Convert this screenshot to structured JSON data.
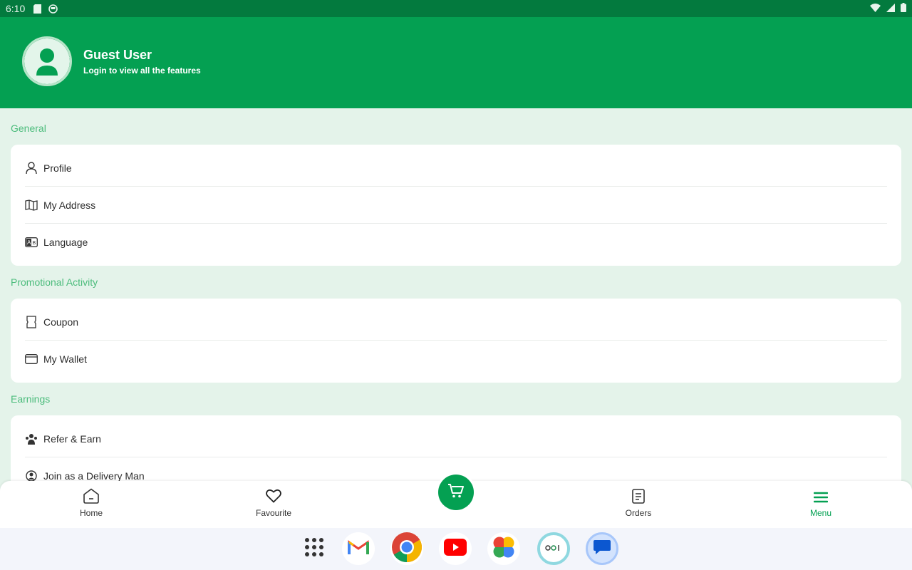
{
  "status_bar": {
    "time": "6:10",
    "icons": [
      "sd-card-icon",
      "face-icon",
      "wifi-icon",
      "signal-icon",
      "battery-icon"
    ]
  },
  "header": {
    "user_name": "Guest User",
    "subtitle": "Login to view all the features",
    "bg_color": "#04a052"
  },
  "sections": [
    {
      "title": "General",
      "items": [
        {
          "label": "Profile",
          "icon": "person-icon"
        },
        {
          "label": "My Address",
          "icon": "map-icon"
        },
        {
          "label": "Language",
          "icon": "language-icon"
        }
      ]
    },
    {
      "title": "Promotional Activity",
      "items": [
        {
          "label": "Coupon",
          "icon": "coupon-icon"
        },
        {
          "label": "My Wallet",
          "icon": "wallet-icon"
        }
      ]
    },
    {
      "title": "Earnings",
      "items": [
        {
          "label": "Refer & Earn",
          "icon": "refer-icon"
        },
        {
          "label": "Join as a Delivery Man",
          "icon": "delivery-man-icon"
        }
      ]
    }
  ],
  "bottom_nav": {
    "items": [
      {
        "label": "Home",
        "icon": "home-icon"
      },
      {
        "label": "Favourite",
        "icon": "heart-icon"
      },
      {
        "label": "Orders",
        "icon": "orders-icon"
      },
      {
        "label": "Menu",
        "icon": "menu-icon",
        "active": true
      }
    ],
    "cart_icon": "cart-icon",
    "accent_color": "#04a052"
  },
  "taskbar": {
    "apps": [
      "app-drawer-icon",
      "gmail-icon",
      "chrome-icon",
      "youtube-icon",
      "photos-icon",
      "app-icon",
      "messages-icon"
    ]
  }
}
